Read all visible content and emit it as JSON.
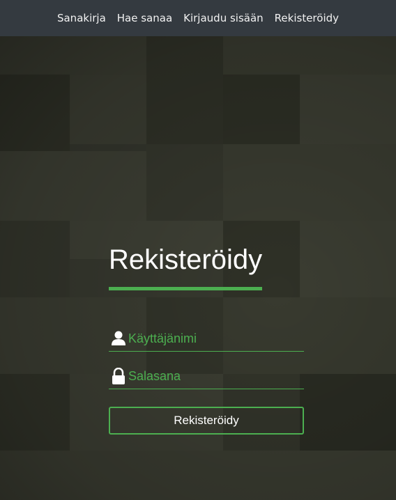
{
  "navbar": {
    "links": [
      {
        "label": "Sanakirja"
      },
      {
        "label": "Hae sanaa"
      },
      {
        "label": "Kirjaudu sisään"
      },
      {
        "label": "Rekisteröidy"
      }
    ]
  },
  "form": {
    "title": "Rekisteröidy",
    "username_placeholder": "Käyttäjänimi",
    "password_placeholder": "Salasana",
    "submit_label": "Rekisteröidy"
  },
  "colors": {
    "accent": "#4caf50",
    "navbar_bg": "#343a40",
    "text": "#ffffff"
  }
}
